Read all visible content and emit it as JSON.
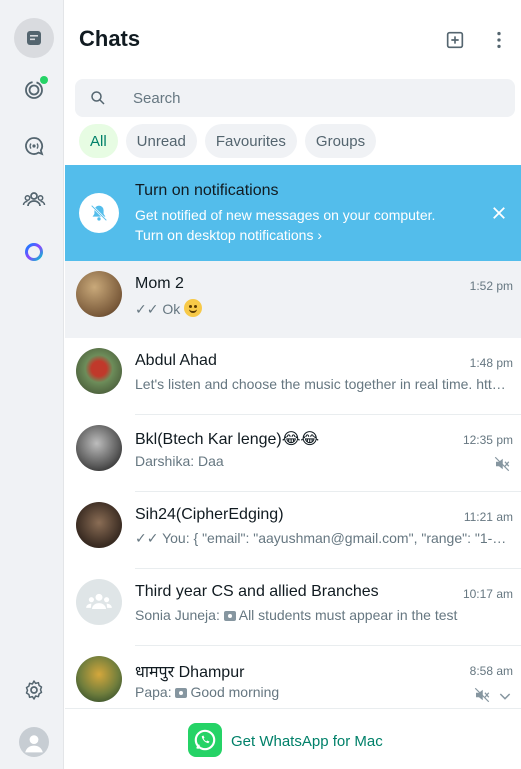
{
  "rail": {
    "items": [
      {
        "name": "chats",
        "icon": "chats-icon",
        "active": true
      },
      {
        "name": "status",
        "icon": "status-icon",
        "active": false
      },
      {
        "name": "channels",
        "icon": "channels-icon",
        "active": false
      },
      {
        "name": "communities",
        "icon": "communities-icon",
        "active": false
      },
      {
        "name": "meta-ai",
        "icon": "meta-ai-icon",
        "active": false
      }
    ],
    "bottom": [
      {
        "name": "settings",
        "icon": "gear-icon"
      },
      {
        "name": "profile",
        "icon": "avatar-icon"
      }
    ]
  },
  "header": {
    "title": "Chats",
    "new_chat_icon": "new-chat-icon",
    "menu_icon": "kebab-menu-icon"
  },
  "search": {
    "placeholder": "Search"
  },
  "filters": [
    "All",
    "Unread",
    "Favourites",
    "Groups"
  ],
  "banner": {
    "title": "Turn on notifications",
    "subtitle": "Get notified of new messages on your computer.",
    "link": "Turn on desktop notifications ›"
  },
  "chats": [
    {
      "name": "Mom 2",
      "time": "1:52 pm",
      "preview": "✓✓ Ok"
    },
    {
      "name": "Abdul Ahad",
      "time": "1:48 pm",
      "preview": "Let's listen and choose the music together in real time. https://..."
    },
    {
      "name": "Bkl(Btech Kar lenge)😂😂",
      "time": "12:35 pm",
      "preview": "Darshika: Daa"
    },
    {
      "name": "Sih24(CipherEdging)",
      "time": "11:21 am",
      "preview": "✓✓ You: { \"email\": \"aayushman@gmail.com\", \"range\": \"1-12-24 ..."
    },
    {
      "name": "Third year CS and allied Branches",
      "time": "10:17 am",
      "preview_sender": "Sonia Juneja:",
      "preview": "All students must appear in the test"
    },
    {
      "name": "धामपुर Dhampur",
      "time": "8:58 am",
      "preview_sender": "Papa:",
      "preview": "Good morning"
    }
  ],
  "footer": {
    "label": "Get WhatsApp for Mac"
  },
  "colors": {
    "accent": "#25d366",
    "banner": "#53bdeb",
    "chip_active_bg": "#e7fce3",
    "chip_active_text": "#008069"
  }
}
